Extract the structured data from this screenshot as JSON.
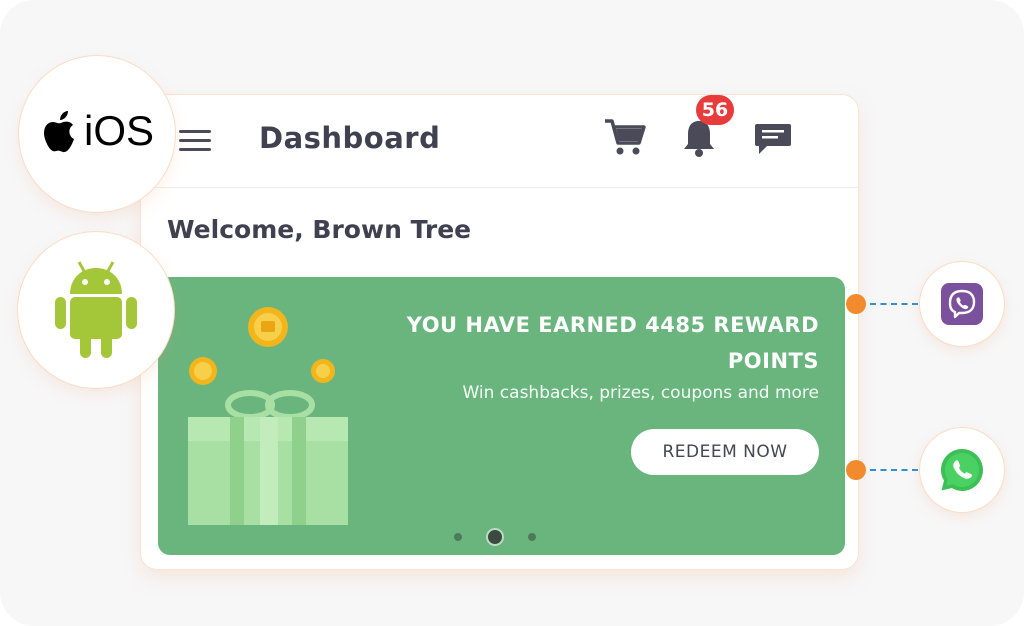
{
  "header": {
    "title": "Dashboard",
    "notification_count": "56"
  },
  "welcome": "Welcome, Brown Tree",
  "banner": {
    "title": "YOU HAVE EARNED 4485 REWARD POINTS",
    "subtitle": "Win cashbacks, prizes, coupons and more",
    "cta_label": "REDEEM NOW",
    "pages": 3,
    "active_page": 2
  },
  "platforms": {
    "ios_label": "iOS"
  },
  "icons": {
    "menu": "hamburger-menu-icon",
    "cart": "shopping-cart-icon",
    "bell": "bell-icon",
    "chat": "chat-bubble-icon",
    "apple": "apple-logo-icon",
    "android": "android-robot-icon",
    "viber": "viber-icon",
    "whatsapp": "whatsapp-icon"
  },
  "colors": {
    "banner": "#6ab57e",
    "badge": "#e83c3c",
    "connector": "#f28a2e",
    "viber": "#7b519d",
    "whatsapp": "#3dbf55",
    "android": "#a4c639"
  }
}
